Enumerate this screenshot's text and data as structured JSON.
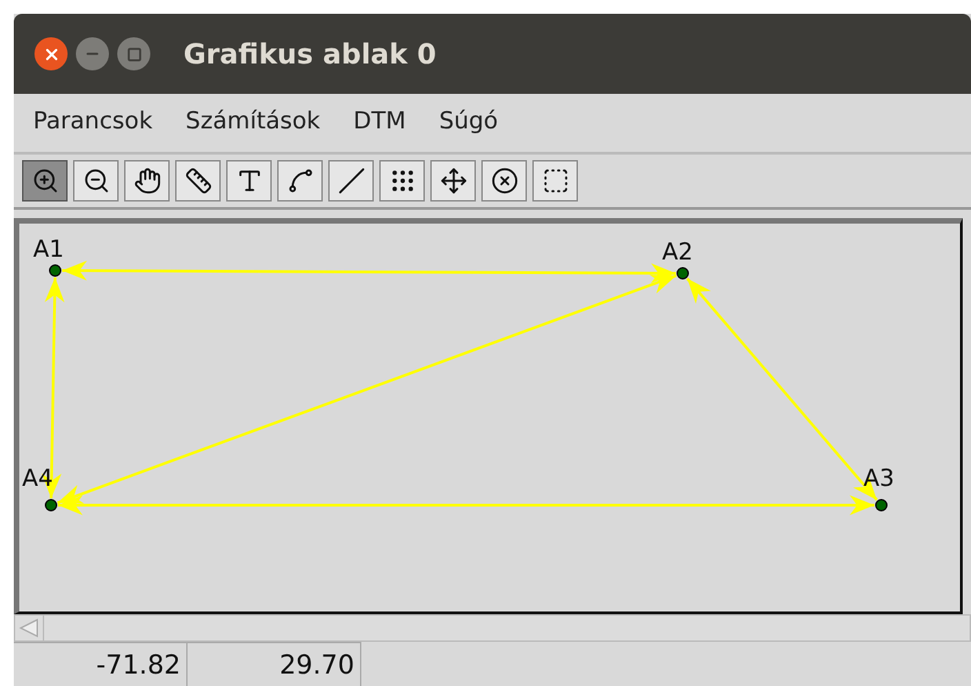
{
  "window": {
    "title": "Grafikus ablak 0"
  },
  "menu": [
    "Parancsok",
    "Számítások",
    "DTM",
    "Súgó"
  ],
  "toolbar": [
    {
      "selected": true
    },
    {
      "selected": false
    },
    {
      "selected": false
    },
    {
      "selected": false
    },
    {
      "selected": false
    },
    {
      "selected": false
    },
    {
      "selected": false
    },
    {
      "selected": false
    },
    {
      "selected": false
    },
    {
      "selected": false
    },
    {
      "selected": false
    }
  ],
  "points": [
    {
      "label": "A1"
    },
    {
      "label": "A2"
    },
    {
      "label": "A4"
    },
    {
      "label": "A3"
    }
  ],
  "status_bar": [
    "-71.82",
    "29.70"
  ]
}
